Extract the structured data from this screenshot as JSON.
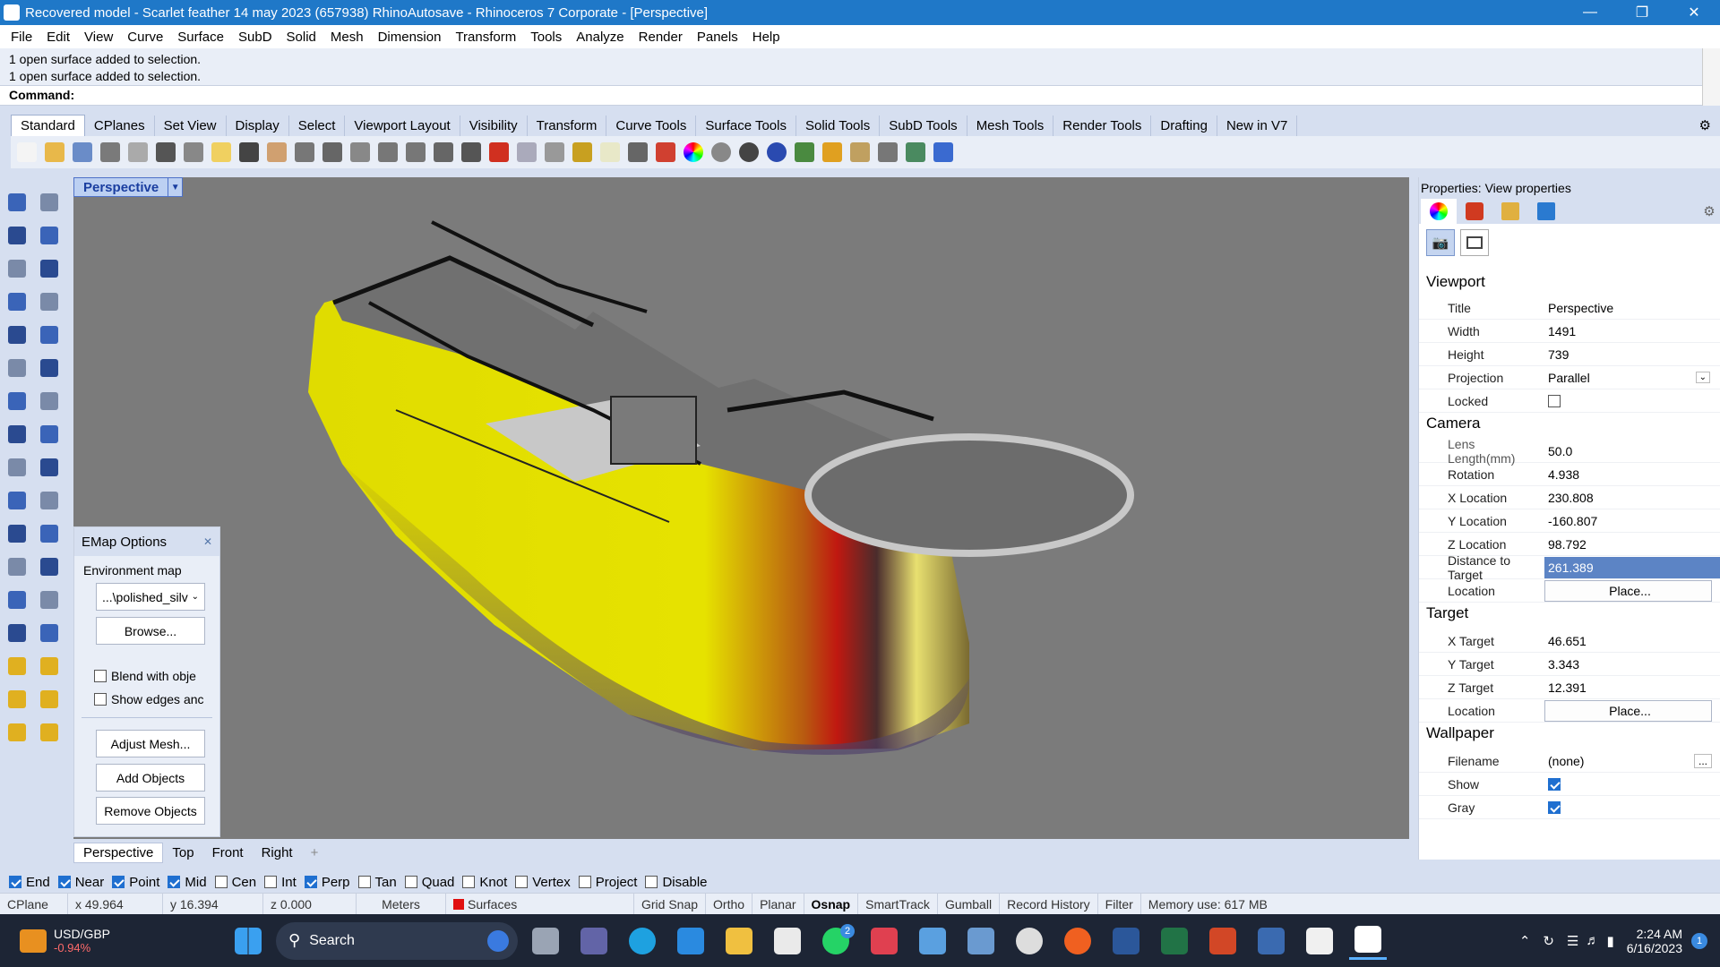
{
  "window": {
    "title": "Recovered model - Scarlet feather 14 may 2023 (657938) RhinoAutosave - Rhinoceros 7 Corporate - [Perspective]"
  },
  "menu": [
    "File",
    "Edit",
    "View",
    "Curve",
    "Surface",
    "SubD",
    "Solid",
    "Mesh",
    "Dimension",
    "Transform",
    "Tools",
    "Analyze",
    "Render",
    "Panels",
    "Help"
  ],
  "command": {
    "history": [
      "1 open surface added to selection.",
      "1 open surface added to selection."
    ],
    "prompt": "Command:"
  },
  "toolbar_tabs": [
    "Standard",
    "CPlanes",
    "Set View",
    "Display",
    "Select",
    "Viewport Layout",
    "Visibility",
    "Transform",
    "Curve Tools",
    "Surface Tools",
    "Solid Tools",
    "SubD Tools",
    "Mesh Tools",
    "Render Tools",
    "Drafting",
    "New in V7"
  ],
  "toolbar_icons": [
    "new-file-icon",
    "open-file-icon",
    "save-icon",
    "print-icon",
    "export-icon",
    "cut-icon",
    "copy-icon",
    "paste-icon",
    "undo-icon",
    "pan-hand-icon",
    "pan-icon",
    "zoom-icon",
    "zoom-window-icon",
    "zoom-extents-icon",
    "zoom-selected-icon",
    "rotate-view-icon",
    "four-view-icon",
    "car-icon",
    "grid-plane-icon",
    "cplane-icon",
    "snap-icon",
    "light-icon",
    "lock-icon",
    "material-icon",
    "color-wheel-icon",
    "shade-icon",
    "render-sphere-icon",
    "render-icon",
    "environment-icon",
    "filter-icon",
    "settings-gear-icon",
    "dimension-icon",
    "web-icon",
    "help-icon"
  ],
  "viewport": {
    "name": "Perspective",
    "tabs": [
      "Perspective",
      "Top",
      "Front",
      "Right"
    ],
    "add_tab": "+"
  },
  "emap": {
    "title": "EMap Options",
    "section": "Environment map",
    "map_value": "...\\polished_silv",
    "browse": "Browse...",
    "blend": "Blend with obje",
    "show_edges": "Show edges anc",
    "adjust": "Adjust Mesh...",
    "add": "Add Objects",
    "remove": "Remove Objects"
  },
  "properties": {
    "header": "Properties: View properties",
    "viewport": {
      "section": "Viewport",
      "title_k": "Title",
      "title_v": "Perspective",
      "width_k": "Width",
      "width_v": "1491",
      "height_k": "Height",
      "height_v": "739",
      "proj_k": "Projection",
      "proj_v": "Parallel",
      "locked_k": "Locked"
    },
    "camera": {
      "section": "Camera",
      "lens_k": "Lens Length(mm)",
      "lens_v": "50.0",
      "rot_k": "Rotation",
      "rot_v": "4.938",
      "x_k": "X Location",
      "x_v": "230.808",
      "y_k": "Y Location",
      "y_v": "-160.807",
      "z_k": "Z Location",
      "z_v": "98.792",
      "dist_k": "Distance to Target",
      "dist_v": "261.389",
      "loc_k": "Location",
      "loc_btn": "Place..."
    },
    "target": {
      "section": "Target",
      "x_k": "X Target",
      "x_v": "46.651",
      "y_k": "Y Target",
      "y_v": "3.343",
      "z_k": "Z Target",
      "z_v": "12.391",
      "loc_k": "Location",
      "loc_btn": "Place..."
    },
    "wallpaper": {
      "section": "Wallpaper",
      "file_k": "Filename",
      "file_v": "(none)",
      "file_btn": "...",
      "show_k": "Show",
      "gray_k": "Gray"
    }
  },
  "osnaps": [
    {
      "label": "End",
      "on": true
    },
    {
      "label": "Near",
      "on": true
    },
    {
      "label": "Point",
      "on": true
    },
    {
      "label": "Mid",
      "on": true
    },
    {
      "label": "Cen",
      "on": false
    },
    {
      "label": "Int",
      "on": false
    },
    {
      "label": "Perp",
      "on": true
    },
    {
      "label": "Tan",
      "on": false
    },
    {
      "label": "Quad",
      "on": false
    },
    {
      "label": "Knot",
      "on": false
    },
    {
      "label": "Vertex",
      "on": false
    },
    {
      "label": "Project",
      "on": false
    },
    {
      "label": "Disable",
      "on": false
    }
  ],
  "status": {
    "cplane": "CPlane",
    "x": "x 49.964",
    "y": "y 16.394",
    "z": "z 0.000",
    "units": "Meters",
    "layer": "Surfaces",
    "grid_snap": "Grid Snap",
    "ortho": "Ortho",
    "planar": "Planar",
    "osnap": "Osnap",
    "smarttrack": "SmartTrack",
    "gumball": "Gumball",
    "record": "Record History",
    "filter": "Filter",
    "memory": "Memory use: 617 MB"
  },
  "taskbar": {
    "ticker_symbol": "USD/GBP",
    "ticker_change": "-0.94%",
    "search": "Search",
    "badge": "2",
    "time": "2:24 AM",
    "date": "6/16/2023",
    "notif": "1"
  },
  "colors": {
    "accent": "#1f78c8",
    "viewport_bg": "#7b7b7b",
    "hull_yellow": "#e4e000",
    "highlight": "#5c84c5"
  }
}
